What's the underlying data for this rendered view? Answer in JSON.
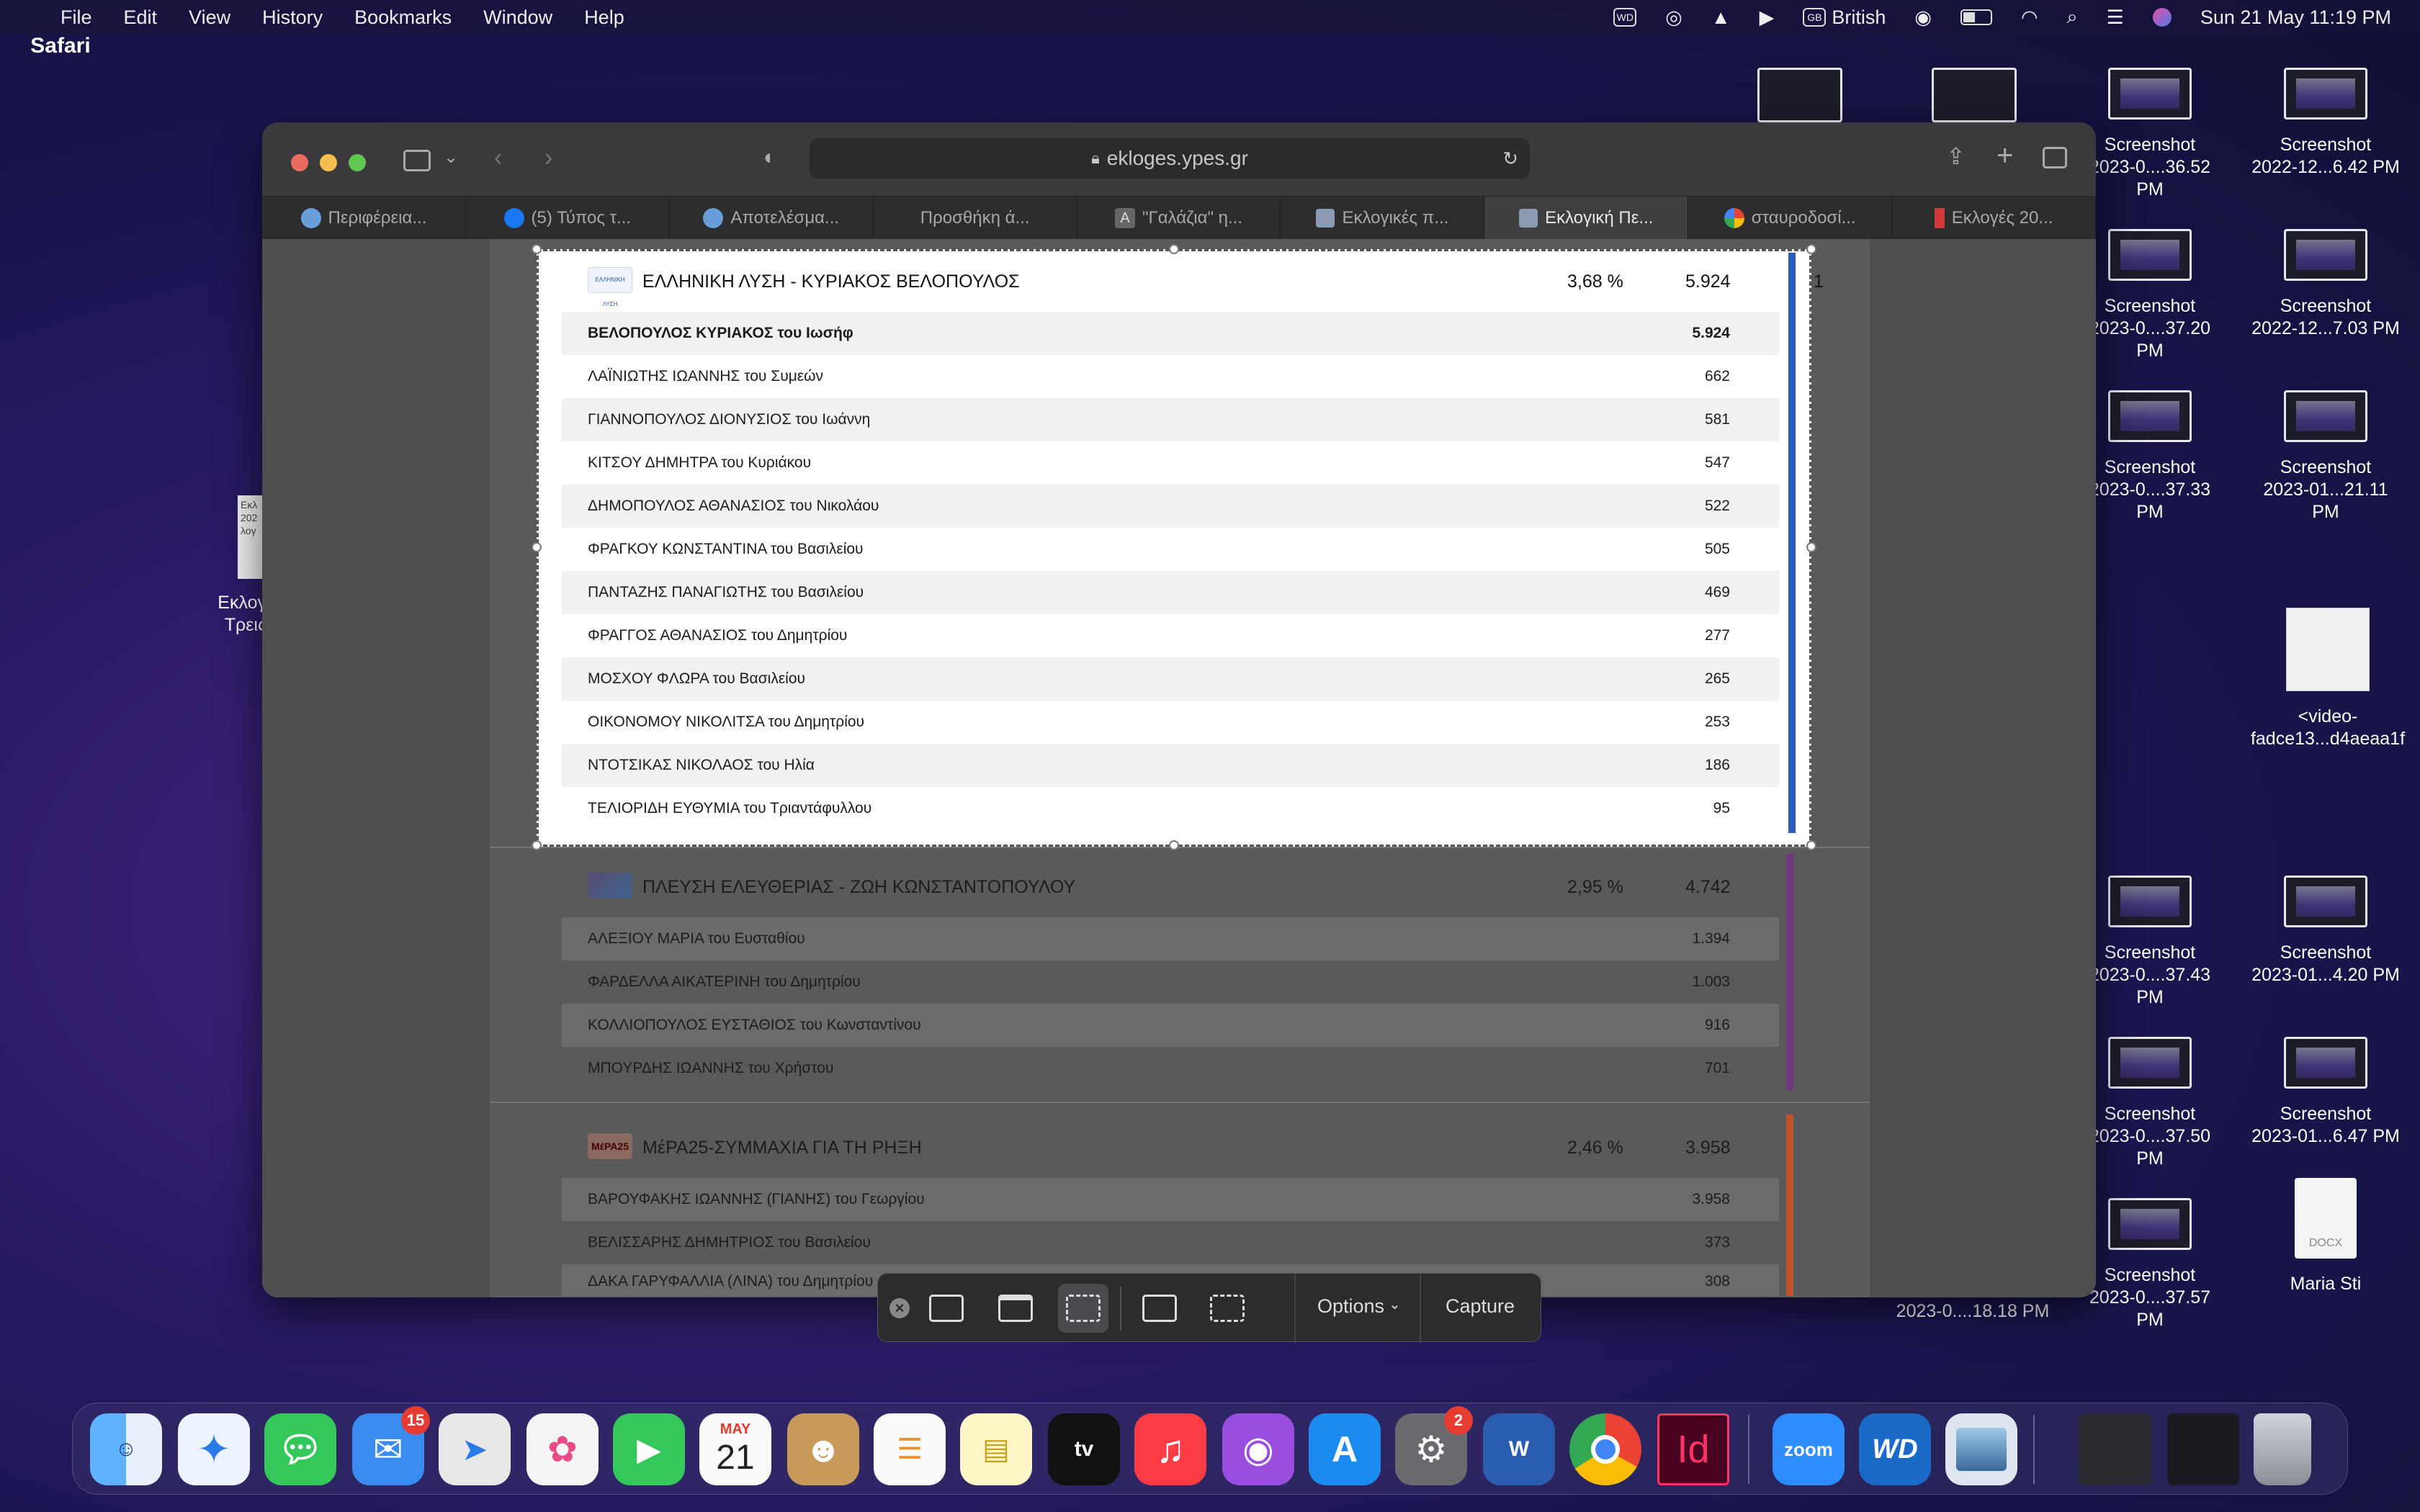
{
  "menubar": {
    "app_name": "Safari",
    "items": [
      "File",
      "Edit",
      "View",
      "History",
      "Bookmarks",
      "Window",
      "Help"
    ],
    "keyboard": "British",
    "datetime": "Sun 21 May  11:19 PM"
  },
  "desktop": {
    "icons": [
      {
        "line1": "Screenshot",
        "line2": "2023-0....36.52 PM"
      },
      {
        "line1": "Screenshot",
        "line2": "2022-12...6.42 PM"
      },
      {
        "line1": "Screenshot",
        "line2": "2023-0....37.20 PM"
      },
      {
        "line1": "Screenshot",
        "line2": "2022-12...7.03 PM"
      },
      {
        "line1": "Screenshot",
        "line2": "2023-0....37.33 PM"
      },
      {
        "line1": "Screenshot",
        "line2": "2023-01...21.11 PM"
      },
      {
        "line1": "<video-",
        "line2": "fadce13...d4aeaa1f"
      },
      {
        "line1": "Screenshot",
        "line2": "2023-0....37.43 PM"
      },
      {
        "line1": "Screenshot",
        "line2": "2023-01...4.20 PM"
      },
      {
        "line1": "Screenshot",
        "line2": "2023-0....37.50 PM"
      },
      {
        "line1": "Screenshot",
        "line2": "2023-01...6.47 PM"
      },
      {
        "line1": "Screenshot",
        "line2": "2023-0....37.57 PM"
      },
      {
        "line1": "Maria Sti",
        "line2": ""
      }
    ],
    "left_file_label1": "Εκλογ",
    "left_file_label2": "Τρεις",
    "left_file_thumb": "Εκλ\n202\nλογ",
    "partial_label": "2023-0....18.18 PM",
    "docx_label": "DOCX"
  },
  "safari": {
    "url": "ekloges.ypes.gr",
    "tabs": [
      "Περιφέρεια...",
      "(5) Τύπος τ...",
      "Αποτελέσμα...",
      "Προσθήκη ά...",
      "\"Γαλάζια\" η...",
      "Εκλογικές π...",
      "Εκλογική Πε...",
      "σταυροδοσί...",
      "Εκλογές 20..."
    ],
    "tab_A": "A"
  },
  "results": {
    "party1": {
      "name": "ΕΛΛΗΝΙΚΗ ΛΥΣΗ - ΚΥΡΙΑΚΟΣ ΒΕΛΟΠΟΥΛΟΣ",
      "pct": "3,68 %",
      "votes": "5.924",
      "seats": "1",
      "logo_text": "ΕΛΛΗΝΙΚΗ ΛΥΣΗ",
      "color": "#2a5cb8",
      "candidates": [
        {
          "name": "ΒΕΛΟΠΟΥΛΟΣ ΚΥΡΙΑΚΟΣ του Ιωσήφ",
          "votes": "5.924"
        },
        {
          "name": "ΛΑΪΝΙΩΤΗΣ ΙΩΑΝΝΗΣ του Συμεών",
          "votes": "662"
        },
        {
          "name": "ΓΙΑΝΝΟΠΟΥΛΟΣ ΔΙΟΝΥΣΙΟΣ του Ιωάννη",
          "votes": "581"
        },
        {
          "name": "ΚΙΤΣΟΥ ΔΗΜΗΤΡΑ του Κυριάκου",
          "votes": "547"
        },
        {
          "name": "ΔΗΜΟΠΟΥΛΟΣ ΑΘΑΝΑΣΙΟΣ του Νικολάου",
          "votes": "522"
        },
        {
          "name": "ΦΡΑΓΚΟΥ ΚΩΝΣΤΑΝΤΙΝΑ του Βασιλείου",
          "votes": "505"
        },
        {
          "name": "ΠΑΝΤΑΖΗΣ ΠΑΝΑΓΙΩΤΗΣ του Βασιλείου",
          "votes": "469"
        },
        {
          "name": "ΦΡΑΓΓΟΣ ΑΘΑΝΑΣΙΟΣ του Δημητρίου",
          "votes": "277"
        },
        {
          "name": "ΜΟΣΧΟΥ ΦΛΩΡΑ του Βασιλείου",
          "votes": "265"
        },
        {
          "name": "ΟΙΚΟΝΟΜΟΥ ΝΙΚΟΛΙΤΣΑ του Δημητρίου",
          "votes": "253"
        },
        {
          "name": "ΝΤΟΤΣΙΚΑΣ ΝΙΚΟΛΑΟΣ του Ηλία",
          "votes": "186"
        },
        {
          "name": "ΤΕΛΙΟΡΙΔΗ ΕΥΘΥΜΙΑ του Τριαντάφυλλου",
          "votes": "95"
        }
      ]
    },
    "party2": {
      "name": "ΠΛΕΥΣΗ ΕΛΕΥΘΕΡΙΑΣ - ΖΩΗ ΚΩΝΣΤΑΝΤΟΠΟΥΛΟΥ",
      "pct": "2,95 %",
      "votes": "4.742",
      "color": "#7b2b8e",
      "candidates": [
        {
          "name": "ΑΛΕΞΙΟΥ ΜΑΡΙΑ του Ευσταθίου",
          "votes": "1.394"
        },
        {
          "name": "ΦΑΡΔΕΛΛΑ ΑΙΚΑΤΕΡΙΝΗ του Δημητρίου",
          "votes": "1.003"
        },
        {
          "name": "ΚΟΛΛΙΟΠΟΥΛΟΣ ΕΥΣΤΑΘΙΟΣ του Κωνσταντίνου",
          "votes": "916"
        },
        {
          "name": "ΜΠΟΥΡΔΗΣ ΙΩΑΝΝΗΣ του Χρήστου",
          "votes": "701"
        }
      ]
    },
    "party3": {
      "name": "ΜέΡΑ25-ΣΥΜΜΑΧΙΑ ΓΙΑ ΤΗ ΡΗΞΗ",
      "pct": "2,46 %",
      "votes": "3.958",
      "logo_text": "ΜέΡΑ25",
      "color": "#e0521c",
      "candidates": [
        {
          "name": "ΒΑΡΟΥΦΑΚΗΣ ΙΩΑΝΝΗΣ (ΓΙΑΝΗΣ) του Γεωργίου",
          "votes": "3.958"
        },
        {
          "name": "ΒΕΛΙΣΣΑΡΗΣ ΔΗΜΗΤΡΙΟΣ του Βασιλείου",
          "votes": "373"
        },
        {
          "name": "ΔΑΚΑ ΓΑΡΥΦΑΛΛΙΑ (ΛΙΝΑ) του Δημητρίου",
          "votes": "308"
        }
      ]
    }
  },
  "capture_toolbar": {
    "options_label": "Options",
    "capture_label": "Capture"
  },
  "dock": {
    "mail_badge": "15",
    "calendar_month": "MAY",
    "calendar_day": "21",
    "settings_badge": "2",
    "tv_label": "tv",
    "word_label": "W",
    "indesign_label": "Id",
    "zoom_label": "zoom",
    "wd_label": "WD"
  }
}
